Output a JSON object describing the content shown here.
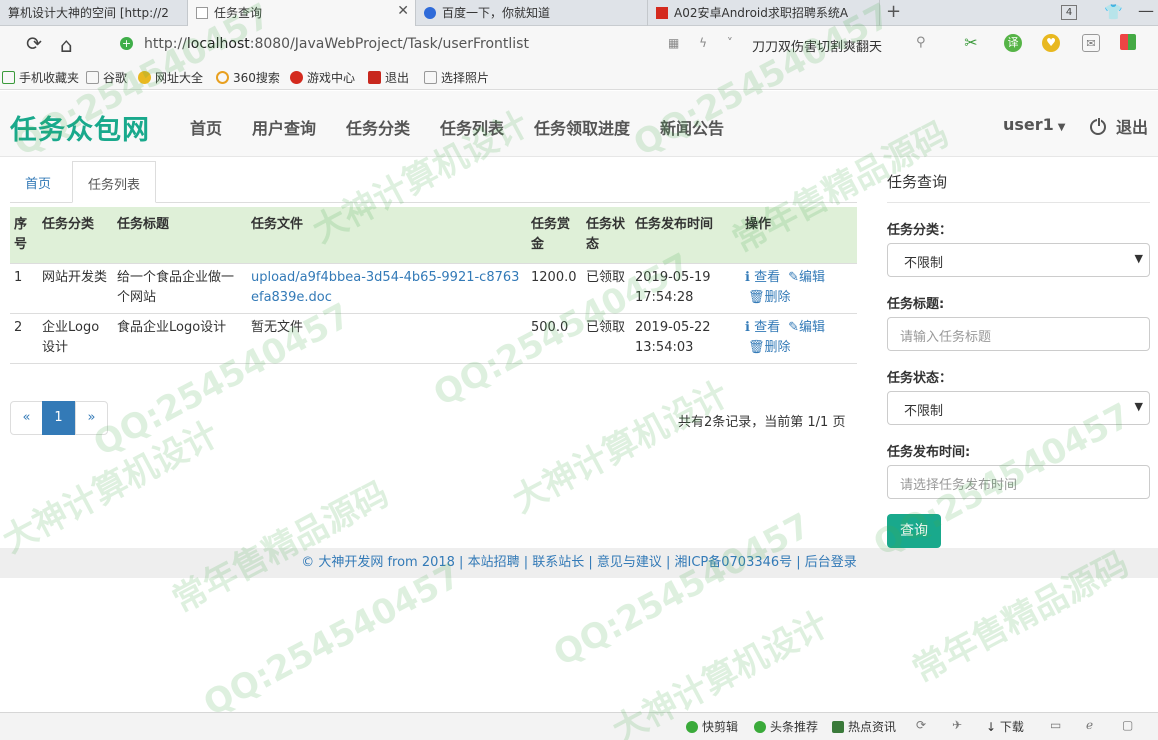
{
  "browser": {
    "tabs": [
      {
        "title": "算机设计大神的空间 [http://2"
      },
      {
        "title": "任务查询"
      },
      {
        "title": "百度一下，你就知道"
      },
      {
        "title": "A02安卓Android求职招聘系统A"
      }
    ],
    "tab_count": "4",
    "url_prefix": "http://",
    "url_host": "localhost",
    "url_rest": ":8080/JavaWebProject/Task/userFrontlist",
    "search_text": "刀刀双伤害切割爽翻天",
    "bookmarks": [
      "手机收藏夹",
      "谷歌",
      "网址大全",
      "360搜索",
      "游戏中心",
      "退出",
      "选择照片"
    ]
  },
  "navbar": {
    "brand": "任务众包网",
    "links": [
      "首页",
      "用户查询",
      "任务分类",
      "任务列表",
      "任务领取进度",
      "新闻公告"
    ],
    "user": "user1",
    "logout": "退出"
  },
  "page_tabs": [
    "首页",
    "任务列表"
  ],
  "table": {
    "headers": [
      "序号",
      "任务分类",
      "任务标题",
      "任务文件",
      "任务赏金",
      "任务状态",
      "任务发布时间",
      "操作"
    ],
    "rows": [
      {
        "no": "1",
        "category": "网站开发类",
        "title": "给一个食品企业做一个网站",
        "file": "upload/a9f4bbea-3d54-4b65-9921-c8763efa839e.doc",
        "reward": "1200.0",
        "status": "已领取",
        "time": "2019-05-19 17:54:28"
      },
      {
        "no": "2",
        "category": "企业Logo设计",
        "title": "食品企业Logo设计",
        "file": "暂无文件",
        "reward": "500.0",
        "status": "已领取",
        "time": "2019-05-22 13:54:03"
      }
    ],
    "ops": {
      "view": "查看",
      "edit": "编辑",
      "delete": "删除"
    }
  },
  "pagination": {
    "prev": "«",
    "current": "1",
    "next": "»",
    "info": "共有2条记录，当前第 1/1 页"
  },
  "query_panel": {
    "title": "任务查询",
    "category_label": "任务分类：",
    "category_value": "不限制",
    "title_label": "任务标题:",
    "title_placeholder": "请输入任务标题",
    "status_label": "任务状态：",
    "status_value": "不限制",
    "time_label": "任务发布时间:",
    "time_placeholder": "请选择任务发布时间",
    "button": "查询"
  },
  "footer": {
    "text": "© 大神开发网 from 2018 | 本站招聘 | 联系站长 | 意见与建议 | 湘ICP备0703346号 | 后台登录"
  },
  "statusbar": {
    "items": [
      "快剪辑",
      "头条推荐",
      "热点资讯",
      "下载"
    ]
  },
  "watermark": {
    "texts": [
      "QQ:254540457",
      "大神计算机设计",
      "常年售精品源码"
    ]
  }
}
